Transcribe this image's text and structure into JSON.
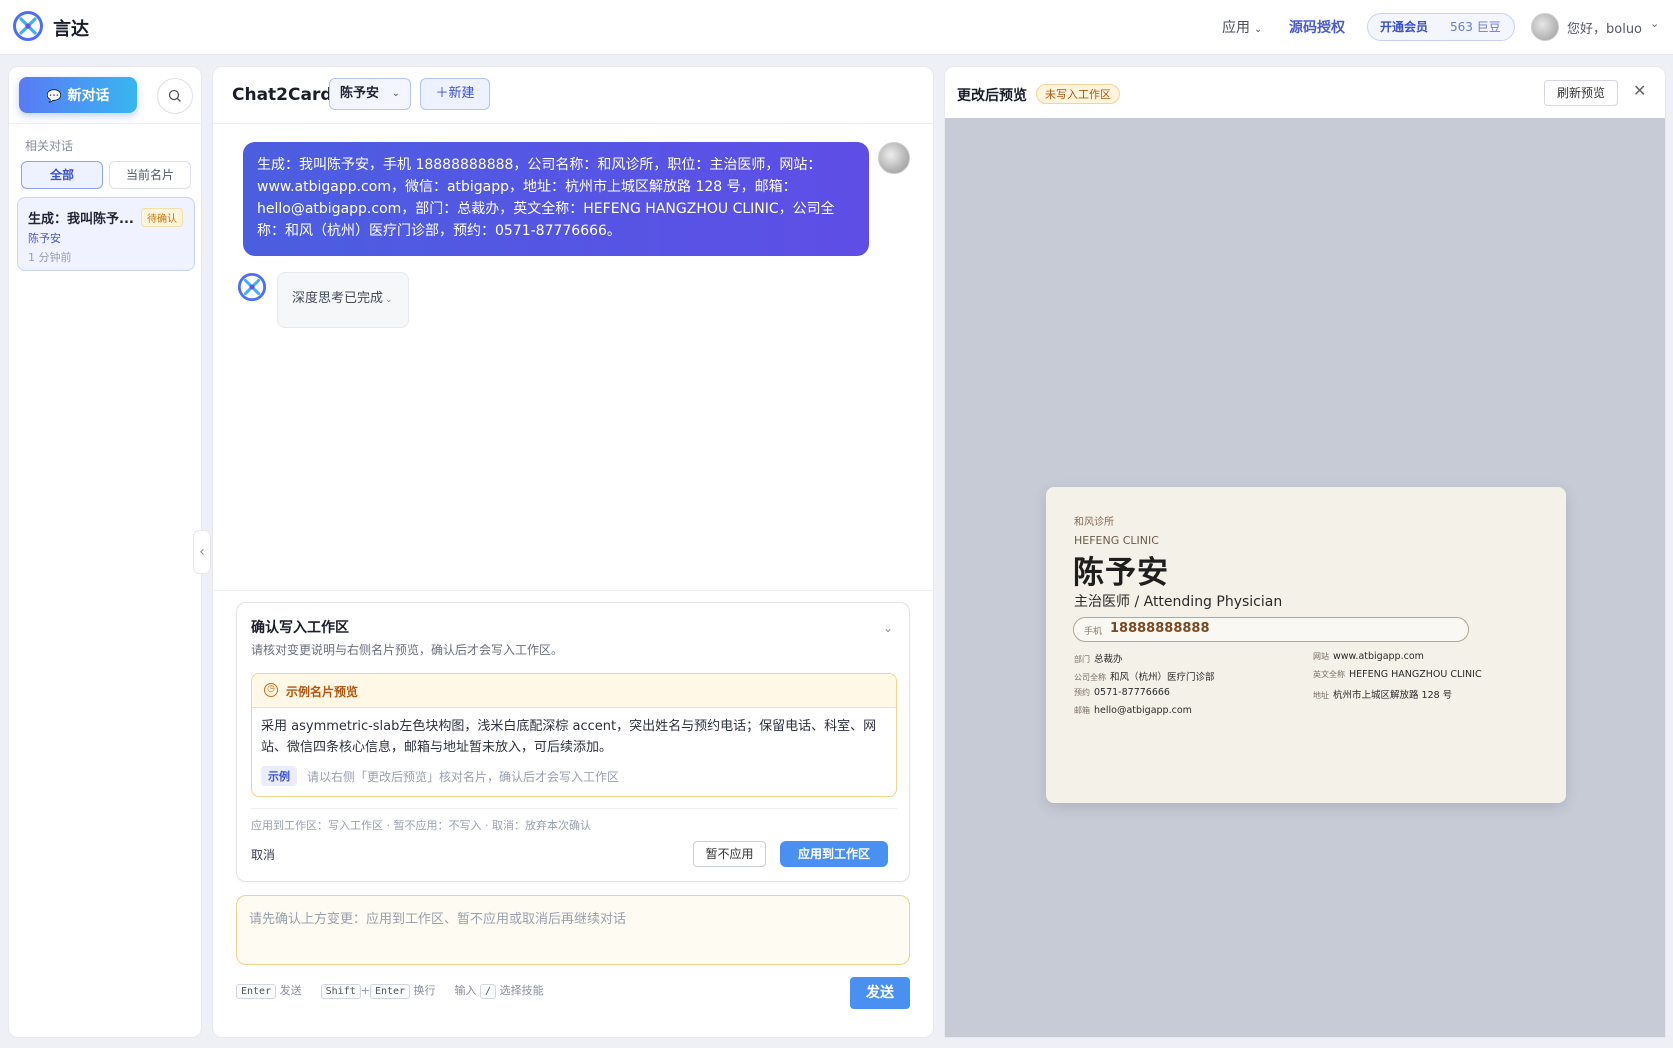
{
  "app": {
    "brand": "言达"
  },
  "topnav": {
    "apps_label": "应用",
    "source_label": "源码授权",
    "member_label": "开通会员",
    "beans": "563 巨豆",
    "greeting": "您好，boluo"
  },
  "sidebar": {
    "new_chat": "新对话",
    "section": "相关对话",
    "filters": [
      "全部",
      "当前名片"
    ],
    "items": [
      {
        "title": "生成：我叫陈予...",
        "badge": "待确认",
        "person": "陈予安",
        "time": "1 分钟前"
      }
    ]
  },
  "chat": {
    "title": "Chat2Card",
    "person": "陈予安",
    "new_label": "新建",
    "user_message": "生成：我叫陈予安，手机 18888888888，公司名称：和风诊所，职位：主治医师，网站：www.atbigapp.com，微信：atbigapp，地址：杭州市上城区解放路 128 号，邮箱：hello@atbigapp.com，部门：总裁办，英文全称：HEFENG HANGZHOU CLINIC，公司全称：和风（杭州）医疗门诊部，预约：0571-87776666。",
    "thinking": "深度思考已完成",
    "confirm": {
      "title": "确认写入工作区",
      "desc": "请核对变更说明与右侧名片预览，确认后才会写入工作区。",
      "example_title": "示例名片预览",
      "example_body": "采用 asymmetric-slab左色块构图，浅米白底配深棕 accent，突出姓名与预约电话；保留电话、科室、网站、微信四条核心信息，邮箱与地址暂未放入，可后续添加。",
      "example_tag": "示例",
      "example_hint": "请以右侧「更改后预览」核对名片，确认后才会写入工作区",
      "legend": "应用到工作区：写入工作区 · 暂不应用：不写入 · 取消：放弃本次确认",
      "cancel": "取消",
      "skip": "暂不应用",
      "apply": "应用到工作区"
    },
    "input_placeholder": "请先确认上方变更：应用到工作区、暂不应用或取消后再继续对话",
    "hints": {
      "enter": "Enter",
      "send": "发送",
      "shift": "Shift",
      "plus": "+",
      "enter2": "Enter",
      "newline": "换行",
      "type": "输入",
      "slash": "/",
      "skill": "选择技能"
    },
    "send": "发送"
  },
  "preview": {
    "title": "更改后预览",
    "badge": "未写入工作区",
    "refresh": "刷新预览"
  },
  "card": {
    "org": "和风诊所",
    "org_en": "HEFENG CLINIC",
    "name": "陈予安",
    "title": "主治医师 / Attending Physician",
    "phone_label": "手机",
    "phone": "18888888888",
    "dept_k": "部门",
    "dept": "总裁办",
    "fullname_k": "公司全称",
    "fullname": "和风（杭州）医疗门诊部",
    "booking_k": "预约",
    "booking": "0571-87776666",
    "email_k": "邮箱",
    "email": "hello@atbigapp.com",
    "web_k": "网站",
    "web": "www.atbigapp.com",
    "en_full_k": "英文全称",
    "en_full": "HEFENG HANGZHOU CLINIC",
    "addr_k": "地址",
    "addr": "杭州市上城区解放路 128 号"
  },
  "colors": {
    "accent": "#4a5bd4",
    "bubble": "#5153e3",
    "primary_btn": "#4a90f0",
    "card_bg": "#f4f1e8"
  }
}
